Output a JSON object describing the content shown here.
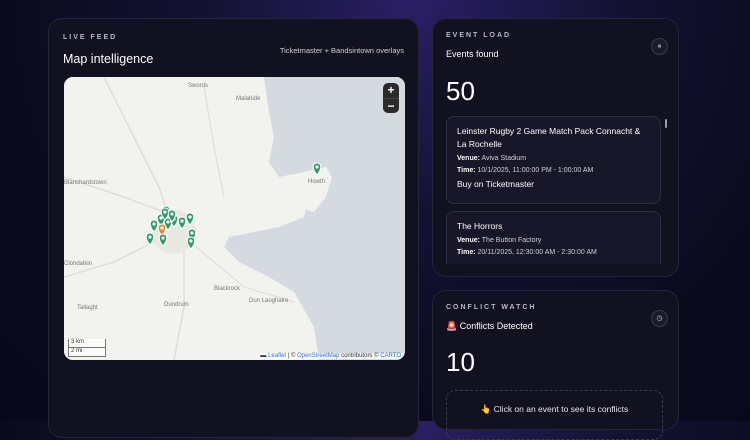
{
  "map_panel": {
    "eyebrow": "LIVE FEED",
    "title": "Map intelligence",
    "overlay_note": "Ticketmaster + Bandsintown overlays",
    "zoom_in": "+",
    "zoom_out": "−",
    "scale_km": "3 km",
    "scale_mi": "2 mi",
    "attribution_leaflet": "Leaflet",
    "attribution_osm": "OpenStreetMap",
    "attribution_mid": " contributors © ",
    "attribution_carto": "CARTO",
    "place_labels": [
      "Swords",
      "Malahide",
      "Howth",
      "Clondalkin",
      "Blackrock",
      "Dun Laoghaire",
      "Dundrum",
      "Tallaght",
      "Blanchardstown"
    ]
  },
  "event_load": {
    "eyebrow": "EVENT LOAD",
    "title": "Events found",
    "count": "50",
    "icon": "pause-icon",
    "events": [
      {
        "name": "Leinster Rugby 2 Game Match Pack Connacht & La Rochelle",
        "venue_label": "Venue:",
        "venue": "Aviva Stadium",
        "time_label": "Time:",
        "time": "10/1/2025, 11:00:00 PM - 1:00:00 AM",
        "link": "Buy on Ticketmaster"
      },
      {
        "name": "The Horrors",
        "venue_label": "Venue:",
        "venue": "The Button Factory",
        "time_label": "Time:",
        "time": "20/11/2025, 12:30:00 AM - 2:30:00 AM"
      }
    ]
  },
  "conflict_watch": {
    "eyebrow": "CONFLICT WATCH",
    "title": "🚨 Conflicts Detected",
    "count": "10",
    "icon": "clock-icon",
    "hint": "👆 Click on an event to see its conflicts"
  },
  "colors": {
    "accent_pin": "#2e9b6a",
    "warning_pin": "#e58a2c",
    "sea": "#d4dadf",
    "land": "#f2f2ef"
  }
}
